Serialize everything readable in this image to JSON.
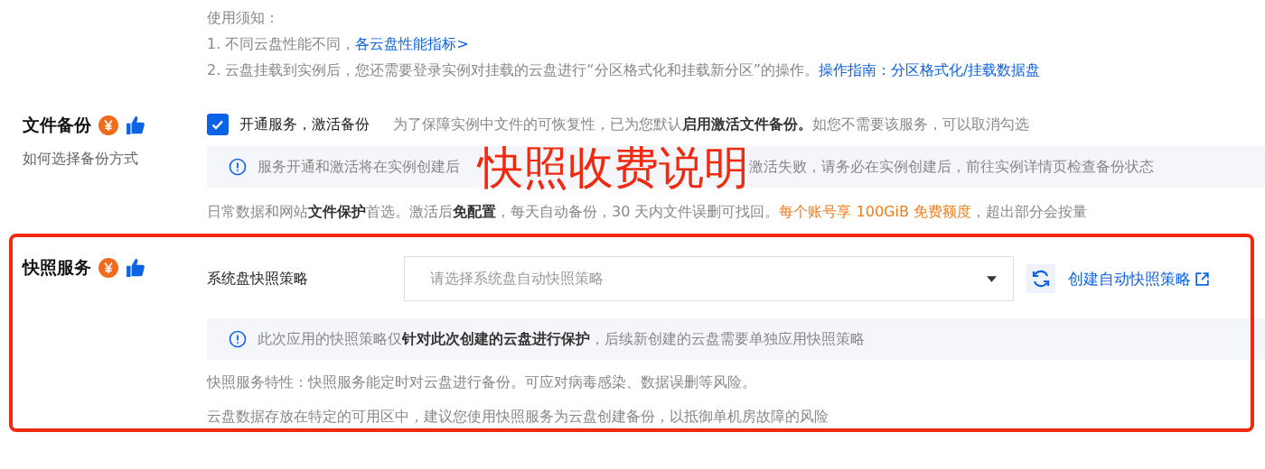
{
  "notice": {
    "title": "使用须知：",
    "items": [
      {
        "text": "1. 不同云盘性能不同，",
        "link": "各云盘性能指标>"
      },
      {
        "text": "2. 云盘挂载到实例后，您还需要登录实例对挂载的云盘进行“分区格式化和挂载新分区”的操作。",
        "link": "操作指南：分区格式化/挂载数据盘"
      }
    ]
  },
  "sections": [
    {
      "title": "文件备份",
      "subtitle": "如何选择备份方式",
      "paid": true,
      "recommended": true,
      "kind": "checkbox",
      "checkbox": {
        "label": "开通服务，激活备份",
        "checked": true,
        "description": "为了保障实例中文件的可恢复性，已为您默认**启用激活文件备份。**如您不需要该服务，可以取消勾选"
      },
      "info": {
        "before": "服务开通和激活将在实例创建后",
        "after": "激活失败，请务必在实例创建后，前往实例详情页检查备份状态"
      },
      "notes": [
        [
          {
            "text": "日常数据和网站**文件保护**首选。激活后**免配置**，每天自动备份，30 天内文件误删可找回。",
            "kind": "plain"
          },
          {
            "text": "每个账号享 100GiB 免费额度",
            "kind": "highlight"
          },
          {
            "text": "，超出部分会按量",
            "kind": "plain"
          }
        ]
      ]
    },
    {
      "title": "快照服务",
      "paid": true,
      "recommended": true,
      "kind": "select",
      "select": {
        "label": "系统盘快照策略",
        "placeholder": "请选择系统盘自动快照策略",
        "link": "创建自动快照策略"
      },
      "info": {
        "text": "此次应用的快照策略仅**针对此次创建的云盘进行保护**，后续新创建的云盘需要单独应用快照策略"
      },
      "notes": [
        [
          {
            "text": "快照服务特性：快照服务能定时对云盘进行备份。可应对病毒感染、数据误删等风险。",
            "kind": "plain"
          }
        ],
        [
          {
            "text": "云盘数据存放在特定的可用区中，建议您使用快照服务为云盘创建备份，以抵御单机房故障的风险",
            "kind": "plain"
          }
        ]
      ]
    }
  ],
  "annotation": {
    "text": "快照收费说明"
  }
}
